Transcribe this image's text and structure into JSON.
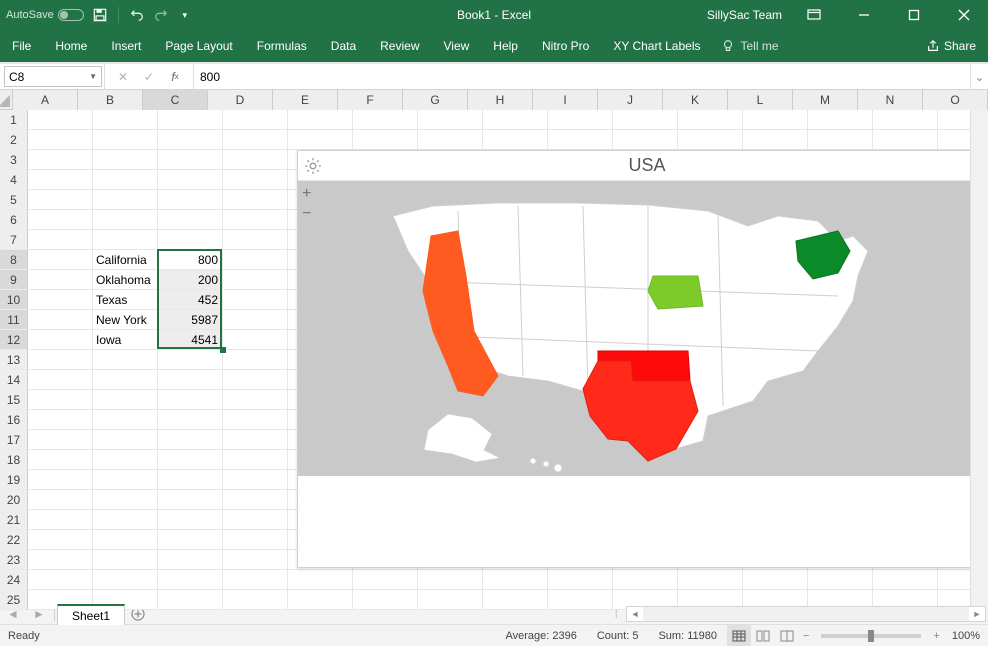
{
  "titlebar": {
    "autosave_label": "AutoSave",
    "autosave_state": "Off",
    "title": "Book1 - Excel",
    "user": "SillySac Team"
  },
  "ribbon": {
    "tabs": [
      "File",
      "Home",
      "Insert",
      "Page Layout",
      "Formulas",
      "Data",
      "Review",
      "View",
      "Help",
      "Nitro Pro",
      "XY Chart Labels"
    ],
    "tellme": "Tell me",
    "share": "Share"
  },
  "formula_bar": {
    "name_box": "C8",
    "formula": "800"
  },
  "columns": {
    "labels": [
      "A",
      "B",
      "C",
      "D",
      "E",
      "F",
      "G",
      "H",
      "I",
      "J",
      "K",
      "L",
      "M",
      "N",
      "O"
    ],
    "widths": [
      65,
      65,
      65,
      65,
      65,
      65,
      65,
      65,
      65,
      65,
      65,
      65,
      65,
      65,
      65
    ],
    "selected_index": 2
  },
  "rows": {
    "first": 1,
    "count": 25,
    "selected": [
      8,
      9,
      10,
      11,
      12
    ]
  },
  "cells": {
    "data": [
      {
        "row": 8,
        "col": "B",
        "text": "California"
      },
      {
        "row": 8,
        "col": "C",
        "text": "800",
        "align": "right"
      },
      {
        "row": 9,
        "col": "B",
        "text": "Oklahoma"
      },
      {
        "row": 9,
        "col": "C",
        "text": "200",
        "align": "right"
      },
      {
        "row": 10,
        "col": "B",
        "text": "Texas"
      },
      {
        "row": 10,
        "col": "C",
        "text": "452",
        "align": "right"
      },
      {
        "row": 11,
        "col": "B",
        "text": "New York"
      },
      {
        "row": 11,
        "col": "C",
        "text": "5987",
        "align": "right"
      },
      {
        "row": 12,
        "col": "B",
        "text": "Iowa"
      },
      {
        "row": 12,
        "col": "C",
        "text": "4541",
        "align": "right"
      }
    ]
  },
  "selection": {
    "start_col": "C",
    "start_row": 8,
    "end_col": "C",
    "end_row": 12
  },
  "chart": {
    "title": "USA",
    "zoom_btns": [
      "+",
      "−"
    ]
  },
  "chart_data": {
    "type": "map",
    "region": "USA",
    "series": [
      {
        "name": "California",
        "value": 800,
        "color": "#ff5a1f"
      },
      {
        "name": "Oklahoma",
        "value": 200,
        "color": "#ff0a0a"
      },
      {
        "name": "Texas",
        "value": 452,
        "color": "#ff2a1a"
      },
      {
        "name": "New York",
        "value": 5987,
        "color": "#0a8a28"
      },
      {
        "name": "Iowa",
        "value": 4541,
        "color": "#7dcb28"
      }
    ]
  },
  "sheet_tabs": {
    "active": "Sheet1"
  },
  "status": {
    "ready": "Ready",
    "agg_avg_label": "Average:",
    "agg_avg": "2396",
    "agg_count_label": "Count:",
    "agg_count": "5",
    "agg_sum_label": "Sum:",
    "agg_sum": "11980",
    "zoom": "100%"
  }
}
